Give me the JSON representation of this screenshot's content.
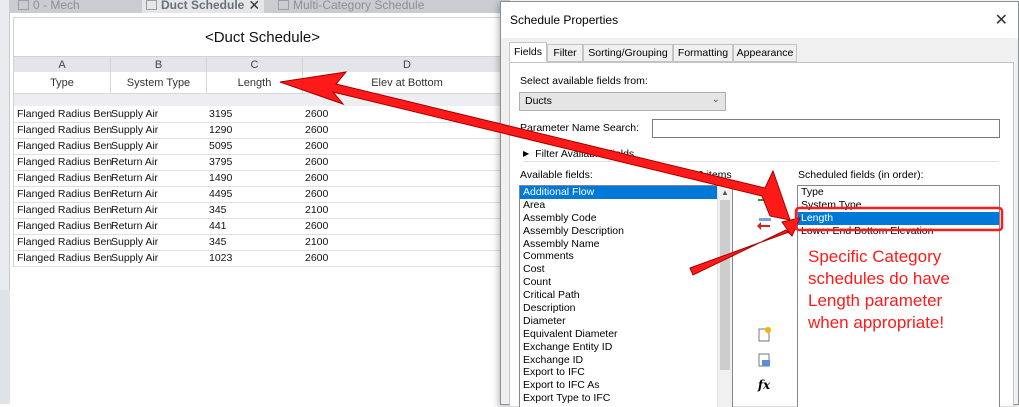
{
  "tabs": [
    {
      "label": "0 - Mech"
    },
    {
      "label": "Duct Schedule"
    },
    {
      "label": "Multi-Category Schedule"
    }
  ],
  "schedule": {
    "title": "<Duct Schedule>",
    "column_letters": [
      "A",
      "B",
      "C",
      "D"
    ],
    "column_headers": [
      "Type",
      "System Type",
      "Length",
      "Elev at Bottom"
    ],
    "rows": [
      [
        "Flanged Radius Ben",
        "Supply Air",
        "3195",
        "2600"
      ],
      [
        "Flanged Radius Ben",
        "Supply Air",
        "1290",
        "2600"
      ],
      [
        "Flanged Radius Ben",
        "Supply Air",
        "5095",
        "2600"
      ],
      [
        "Flanged Radius Ben",
        "Return Air",
        "3795",
        "2600"
      ],
      [
        "Flanged Radius Ben",
        "Return Air",
        "1490",
        "2600"
      ],
      [
        "Flanged Radius Ben",
        "Return Air",
        "4495",
        "2600"
      ],
      [
        "Flanged Radius Ben",
        "Return Air",
        "345",
        "2100"
      ],
      [
        "Flanged Radius Ben",
        "Return Air",
        "441",
        "2600"
      ],
      [
        "Flanged Radius Ben",
        "Supply Air",
        "345",
        "2100"
      ],
      [
        "Flanged Radius Ben",
        "Supply Air",
        "1023",
        "2600"
      ]
    ]
  },
  "dialog": {
    "title": "Schedule Properties",
    "close_glyph": "✕",
    "tabs": [
      "Fields",
      "Filter",
      "Sorting/Grouping",
      "Formatting",
      "Appearance"
    ],
    "select_label": "Select available fields from:",
    "select_value": "Ducts",
    "param_search_label": "Parameter Name Search:",
    "filter_expander": "Filter Available Fields",
    "available_label": "Available fields:",
    "available_count": "69 items",
    "scheduled_label": "Scheduled fields (in order):",
    "available_fields": [
      "Additional Flow",
      "Area",
      "Assembly Code",
      "Assembly Description",
      "Assembly Name",
      "Comments",
      "Cost",
      "Count",
      "Critical Path",
      "Description",
      "Diameter",
      "Equivalent Diameter",
      "Exchange Entity ID",
      "Exchange ID",
      "Export to IFC",
      "Export to IFC As",
      "Export Type to IFC"
    ],
    "available_selected_index": 0,
    "scheduled_fields": [
      "Type",
      "System Type",
      "Length",
      "Lower End Bottom Elevation"
    ],
    "scheduled_selected_index": 2,
    "fx_label": "fx"
  },
  "annotation": {
    "callout_lines": [
      "Specific Category",
      "schedules do have",
      "Length parameter",
      "when appropriate!"
    ],
    "color": "#ff1a1a"
  }
}
